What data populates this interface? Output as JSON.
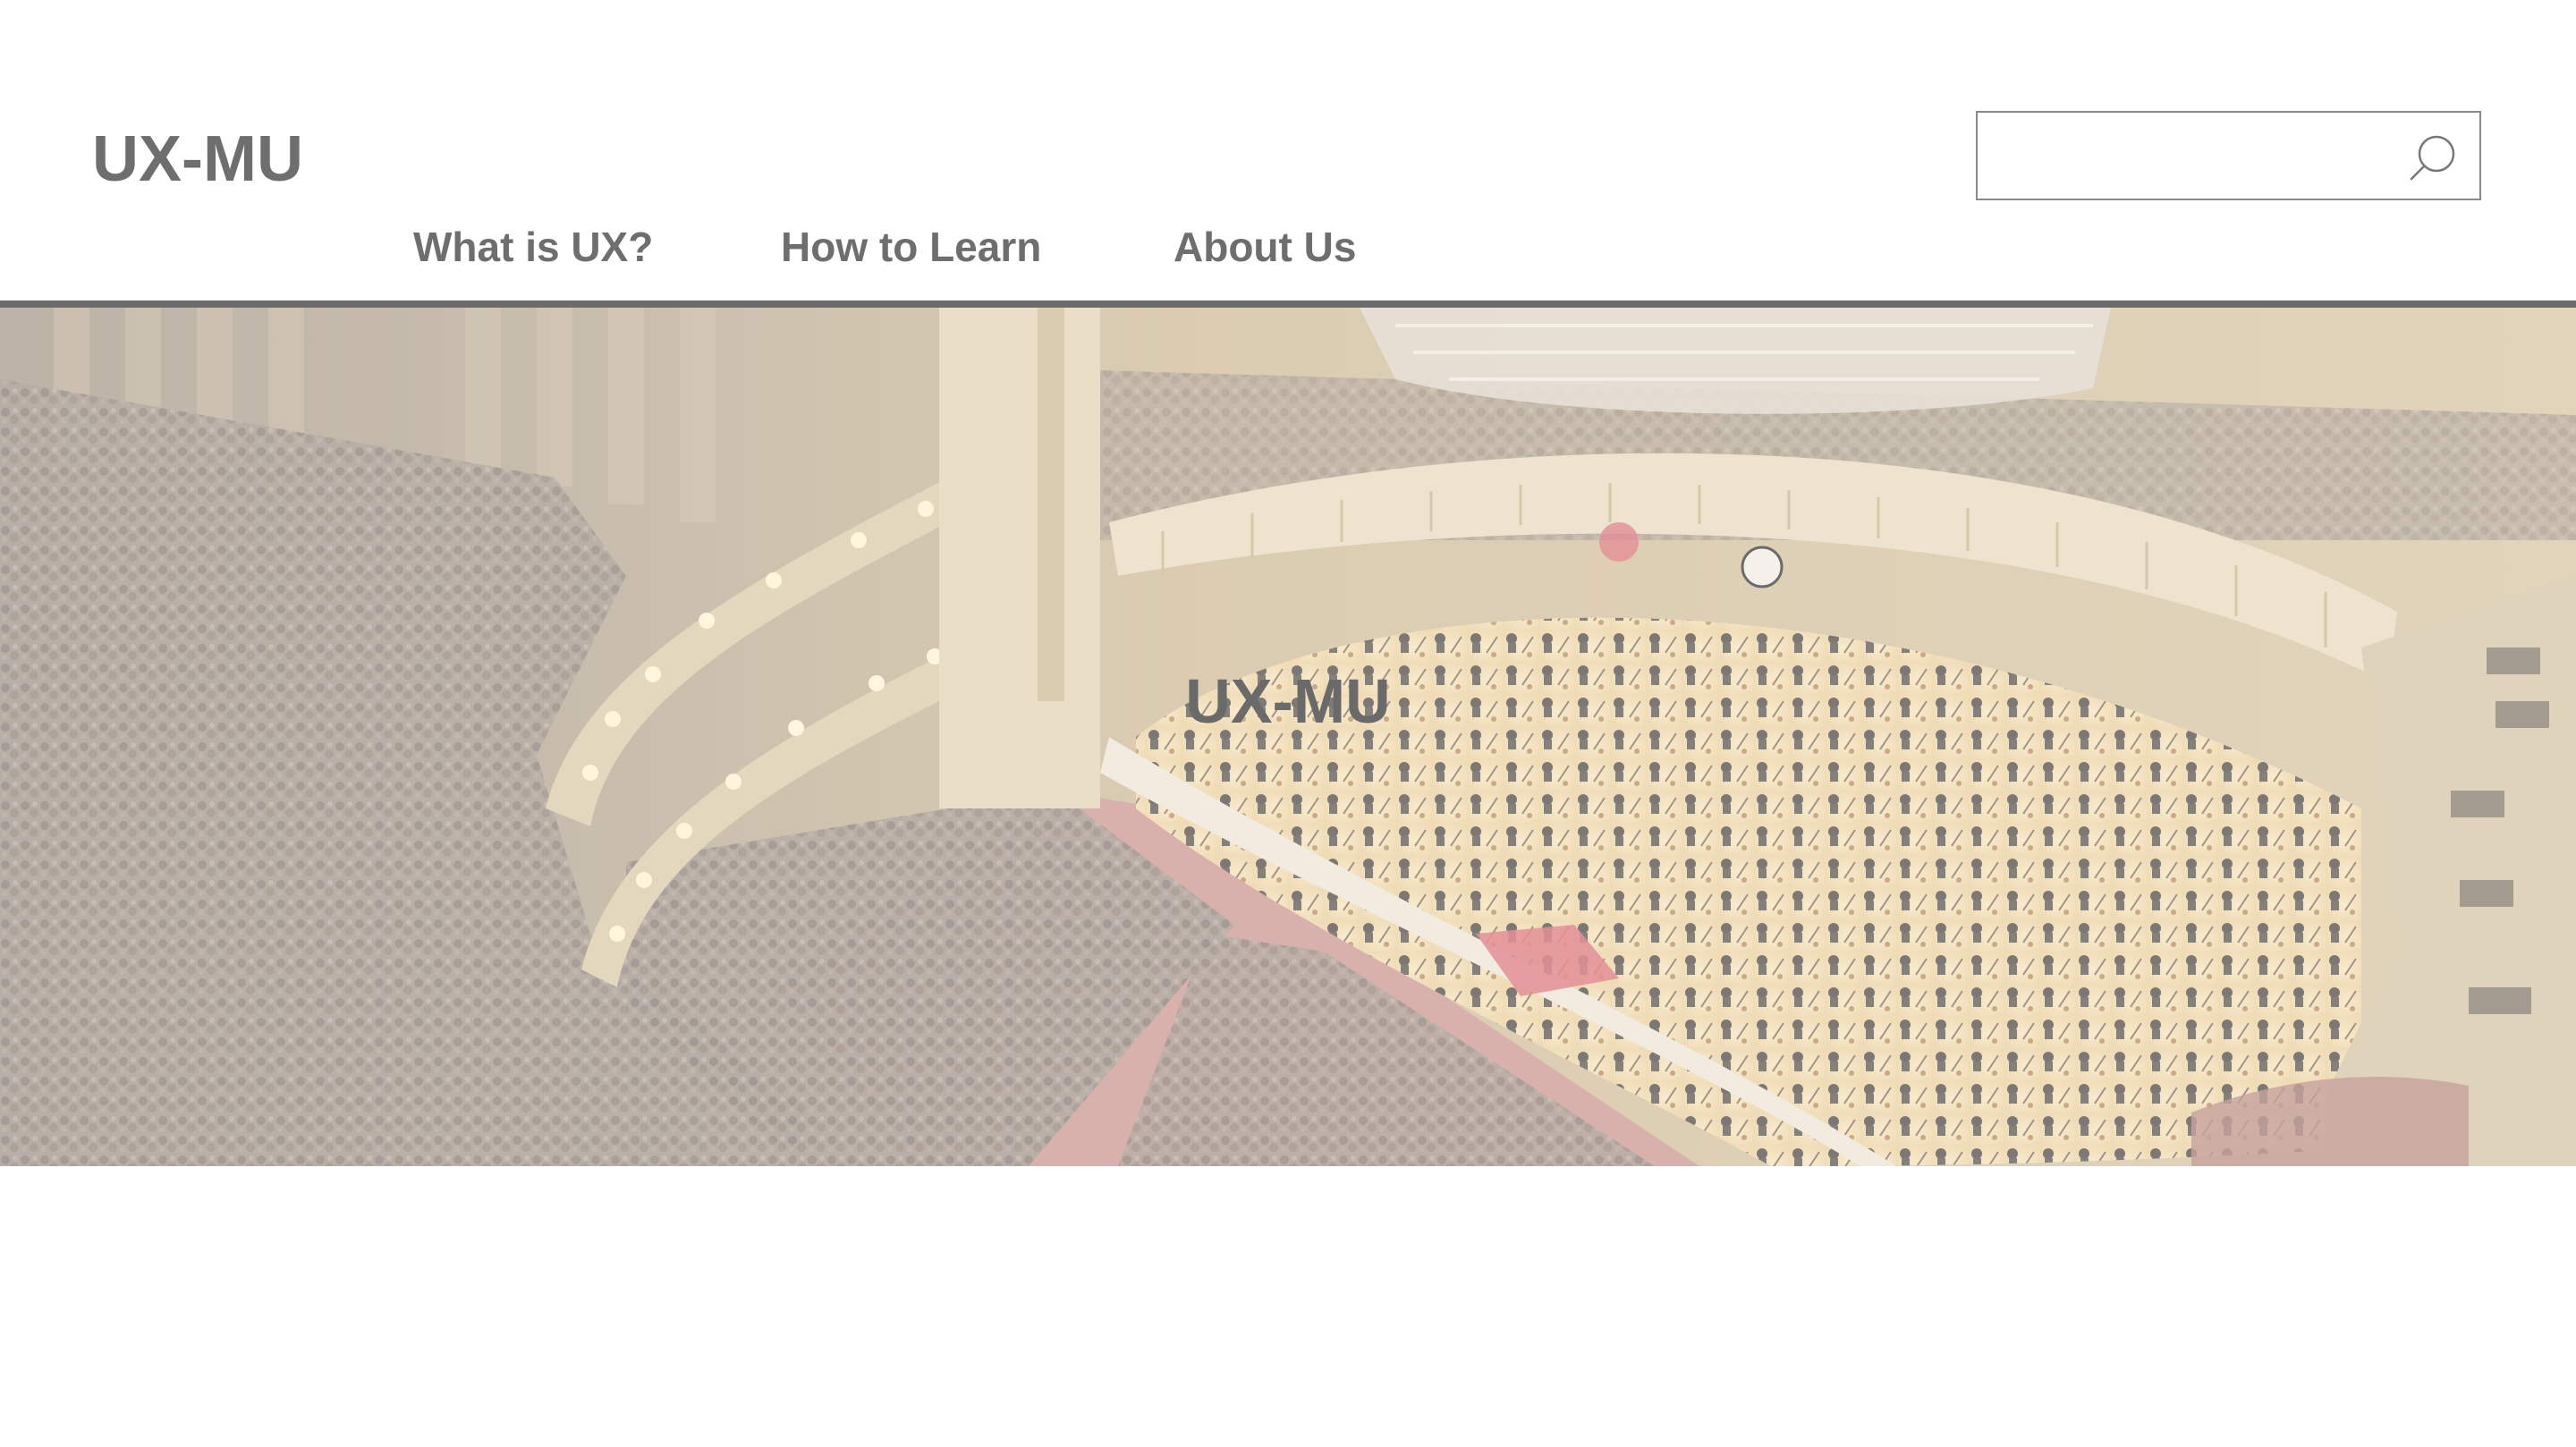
{
  "header": {
    "logo": "UX-MU",
    "search": {
      "value": "",
      "placeholder": "",
      "icon": "search-icon"
    }
  },
  "nav": {
    "items": [
      {
        "label": "What is UX?"
      },
      {
        "label": "How to Learn"
      },
      {
        "label": "About Us"
      }
    ]
  },
  "hero": {
    "title": "UX-MU",
    "image": "concert-hall-orchestra-photo"
  },
  "colors": {
    "text": "#6e6e6e",
    "rule": "#6b6b6b",
    "stage": "#f3dcae",
    "carpet": "#c97b7f"
  }
}
